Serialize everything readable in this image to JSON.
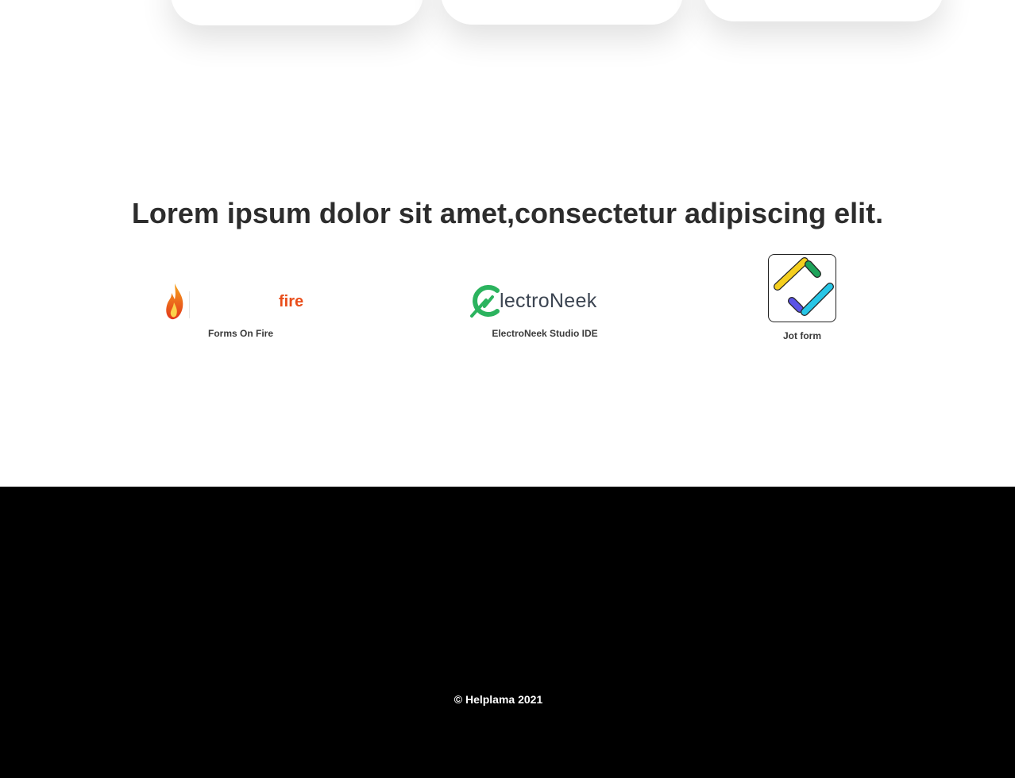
{
  "headline": "Lorem ipsum dolor sit amet,consectetur adipiscing elit.",
  "partners": [
    {
      "name": "Forms On Fire",
      "logo_text": "fire",
      "logo_icon": "flame-icon",
      "accent": "#e94e1b"
    },
    {
      "name": "ElectroNeek Studio IDE",
      "logo_text": "lectroNeek",
      "logo_icon": "electroneek-e-icon",
      "accent": "#2bb35e"
    },
    {
      "name": "Jot form",
      "logo_icon": "jotform-icon"
    }
  ],
  "footer": {
    "copyright": "© Helplama 2021",
    "background": "#000000"
  }
}
